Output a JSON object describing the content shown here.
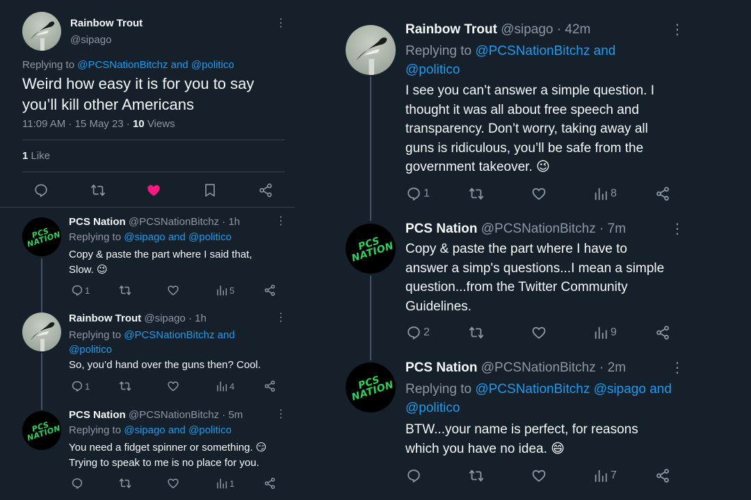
{
  "main_tweet": {
    "name": "Rainbow Trout",
    "handle": "@sipago",
    "replying_prefix": "Replying to",
    "replying_to": "@PCSNationBitchz and @politico",
    "text_line1": "Weird how easy it is for you to say",
    "text_line2": "you’ll kill other Americans",
    "meta_time": "11:09 AM · 15 May 23 · ",
    "views_count": "10",
    "views_label": " Views",
    "likes_count": "1",
    "likes_label": " Like"
  },
  "left_replies": [
    {
      "name": "PCS Nation",
      "handle_time": "@PCSNationBitchz · 1h",
      "replying_prefix": "Replying to",
      "replying_to": "@sipago and @politico",
      "line1": "Copy & paste the part where I said that,",
      "line2": "Slow. 😉",
      "replies": "1",
      "views": "5"
    },
    {
      "name": "Rainbow Trout",
      "handle_time": "@sipago · 1h",
      "replying_prefix": "Replying to",
      "replying_to_line1": "@PCSNationBitchz and",
      "replying_to_line2": "@politico",
      "line1": "So, you’d hand over the guns then?  Cool.",
      "replies": "1",
      "views": "4"
    },
    {
      "name": "PCS Nation",
      "handle_time": "@PCSNationBitchz · 5m",
      "replying_prefix": "Replying to",
      "replying_to": "@sipago and @politico",
      "line1": "You need a fidget spinner or something. 😏",
      "line2": "Trying to speak to me is no place for you.",
      "views": "1"
    }
  ],
  "right_replies": [
    {
      "name": "Rainbow Trout",
      "handle_time": "@sipago · 42m",
      "replying_prefix": "Replying to",
      "replying_to_line1": "@PCSNationBitchz and",
      "replying_to_line2": "@politico",
      "lines": [
        "I see you can’t answer a simple question.  I",
        "thought it was all about free speech and",
        "transparency.  Don’t worry, taking away all",
        "guns is ridiculous,  you’ll be safe from the",
        "government takeover. 😉"
      ],
      "replies": "1",
      "views": "8"
    },
    {
      "name": "PCS Nation",
      "handle_time": "@PCSNationBitchz · 7m",
      "lines": [
        "Copy & paste the part where I have to",
        "answer a simp's questions...I mean a simple",
        "question...from the Twitter Community",
        "Guidelines."
      ],
      "replies": "2",
      "views": "9"
    },
    {
      "name": "PCS Nation",
      "handle_time": "@PCSNationBitchz · 2m",
      "replying_prefix": "Replying to",
      "replying_to_line1": "@PCSNationBitchz @sipago and",
      "replying_to_line2": "@politico",
      "lines": [
        "BTW...your name is perfect, for reasons",
        "which you have no idea. 😄"
      ],
      "views": "7"
    }
  ],
  "avatar_logo_text": "PCS NATION",
  "more_glyph": "⋮",
  "colors": {
    "background": "#15202b",
    "link": "#1d9bf0",
    "muted": "#8b98a5",
    "like_active": "#f91880",
    "logo_green": "#2fd35b"
  },
  "icons": [
    "reply-icon",
    "retweet-icon",
    "like-icon",
    "bookmark-icon",
    "share-icon",
    "views-icon",
    "more-icon"
  ]
}
